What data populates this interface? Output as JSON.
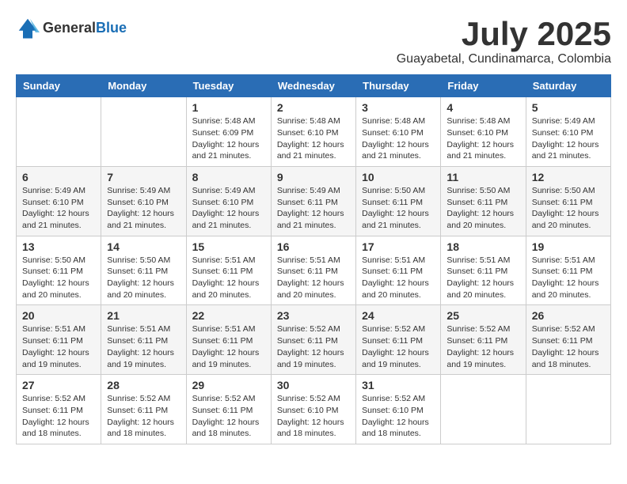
{
  "header": {
    "logo_general": "General",
    "logo_blue": "Blue",
    "month": "July 2025",
    "location": "Guayabetal, Cundinamarca, Colombia"
  },
  "weekdays": [
    "Sunday",
    "Monday",
    "Tuesday",
    "Wednesday",
    "Thursday",
    "Friday",
    "Saturday"
  ],
  "weeks": [
    [
      {
        "day": "",
        "info": ""
      },
      {
        "day": "",
        "info": ""
      },
      {
        "day": "1",
        "info": "Sunrise: 5:48 AM\nSunset: 6:09 PM\nDaylight: 12 hours and 21 minutes."
      },
      {
        "day": "2",
        "info": "Sunrise: 5:48 AM\nSunset: 6:10 PM\nDaylight: 12 hours and 21 minutes."
      },
      {
        "day": "3",
        "info": "Sunrise: 5:48 AM\nSunset: 6:10 PM\nDaylight: 12 hours and 21 minutes."
      },
      {
        "day": "4",
        "info": "Sunrise: 5:48 AM\nSunset: 6:10 PM\nDaylight: 12 hours and 21 minutes."
      },
      {
        "day": "5",
        "info": "Sunrise: 5:49 AM\nSunset: 6:10 PM\nDaylight: 12 hours and 21 minutes."
      }
    ],
    [
      {
        "day": "6",
        "info": "Sunrise: 5:49 AM\nSunset: 6:10 PM\nDaylight: 12 hours and 21 minutes."
      },
      {
        "day": "7",
        "info": "Sunrise: 5:49 AM\nSunset: 6:10 PM\nDaylight: 12 hours and 21 minutes."
      },
      {
        "day": "8",
        "info": "Sunrise: 5:49 AM\nSunset: 6:10 PM\nDaylight: 12 hours and 21 minutes."
      },
      {
        "day": "9",
        "info": "Sunrise: 5:49 AM\nSunset: 6:11 PM\nDaylight: 12 hours and 21 minutes."
      },
      {
        "day": "10",
        "info": "Sunrise: 5:50 AM\nSunset: 6:11 PM\nDaylight: 12 hours and 21 minutes."
      },
      {
        "day": "11",
        "info": "Sunrise: 5:50 AM\nSunset: 6:11 PM\nDaylight: 12 hours and 20 minutes."
      },
      {
        "day": "12",
        "info": "Sunrise: 5:50 AM\nSunset: 6:11 PM\nDaylight: 12 hours and 20 minutes."
      }
    ],
    [
      {
        "day": "13",
        "info": "Sunrise: 5:50 AM\nSunset: 6:11 PM\nDaylight: 12 hours and 20 minutes."
      },
      {
        "day": "14",
        "info": "Sunrise: 5:50 AM\nSunset: 6:11 PM\nDaylight: 12 hours and 20 minutes."
      },
      {
        "day": "15",
        "info": "Sunrise: 5:51 AM\nSunset: 6:11 PM\nDaylight: 12 hours and 20 minutes."
      },
      {
        "day": "16",
        "info": "Sunrise: 5:51 AM\nSunset: 6:11 PM\nDaylight: 12 hours and 20 minutes."
      },
      {
        "day": "17",
        "info": "Sunrise: 5:51 AM\nSunset: 6:11 PM\nDaylight: 12 hours and 20 minutes."
      },
      {
        "day": "18",
        "info": "Sunrise: 5:51 AM\nSunset: 6:11 PM\nDaylight: 12 hours and 20 minutes."
      },
      {
        "day": "19",
        "info": "Sunrise: 5:51 AM\nSunset: 6:11 PM\nDaylight: 12 hours and 20 minutes."
      }
    ],
    [
      {
        "day": "20",
        "info": "Sunrise: 5:51 AM\nSunset: 6:11 PM\nDaylight: 12 hours and 19 minutes."
      },
      {
        "day": "21",
        "info": "Sunrise: 5:51 AM\nSunset: 6:11 PM\nDaylight: 12 hours and 19 minutes."
      },
      {
        "day": "22",
        "info": "Sunrise: 5:51 AM\nSunset: 6:11 PM\nDaylight: 12 hours and 19 minutes."
      },
      {
        "day": "23",
        "info": "Sunrise: 5:52 AM\nSunset: 6:11 PM\nDaylight: 12 hours and 19 minutes."
      },
      {
        "day": "24",
        "info": "Sunrise: 5:52 AM\nSunset: 6:11 PM\nDaylight: 12 hours and 19 minutes."
      },
      {
        "day": "25",
        "info": "Sunrise: 5:52 AM\nSunset: 6:11 PM\nDaylight: 12 hours and 19 minutes."
      },
      {
        "day": "26",
        "info": "Sunrise: 5:52 AM\nSunset: 6:11 PM\nDaylight: 12 hours and 18 minutes."
      }
    ],
    [
      {
        "day": "27",
        "info": "Sunrise: 5:52 AM\nSunset: 6:11 PM\nDaylight: 12 hours and 18 minutes."
      },
      {
        "day": "28",
        "info": "Sunrise: 5:52 AM\nSunset: 6:11 PM\nDaylight: 12 hours and 18 minutes."
      },
      {
        "day": "29",
        "info": "Sunrise: 5:52 AM\nSunset: 6:11 PM\nDaylight: 12 hours and 18 minutes."
      },
      {
        "day": "30",
        "info": "Sunrise: 5:52 AM\nSunset: 6:10 PM\nDaylight: 12 hours and 18 minutes."
      },
      {
        "day": "31",
        "info": "Sunrise: 5:52 AM\nSunset: 6:10 PM\nDaylight: 12 hours and 18 minutes."
      },
      {
        "day": "",
        "info": ""
      },
      {
        "day": "",
        "info": ""
      }
    ]
  ]
}
